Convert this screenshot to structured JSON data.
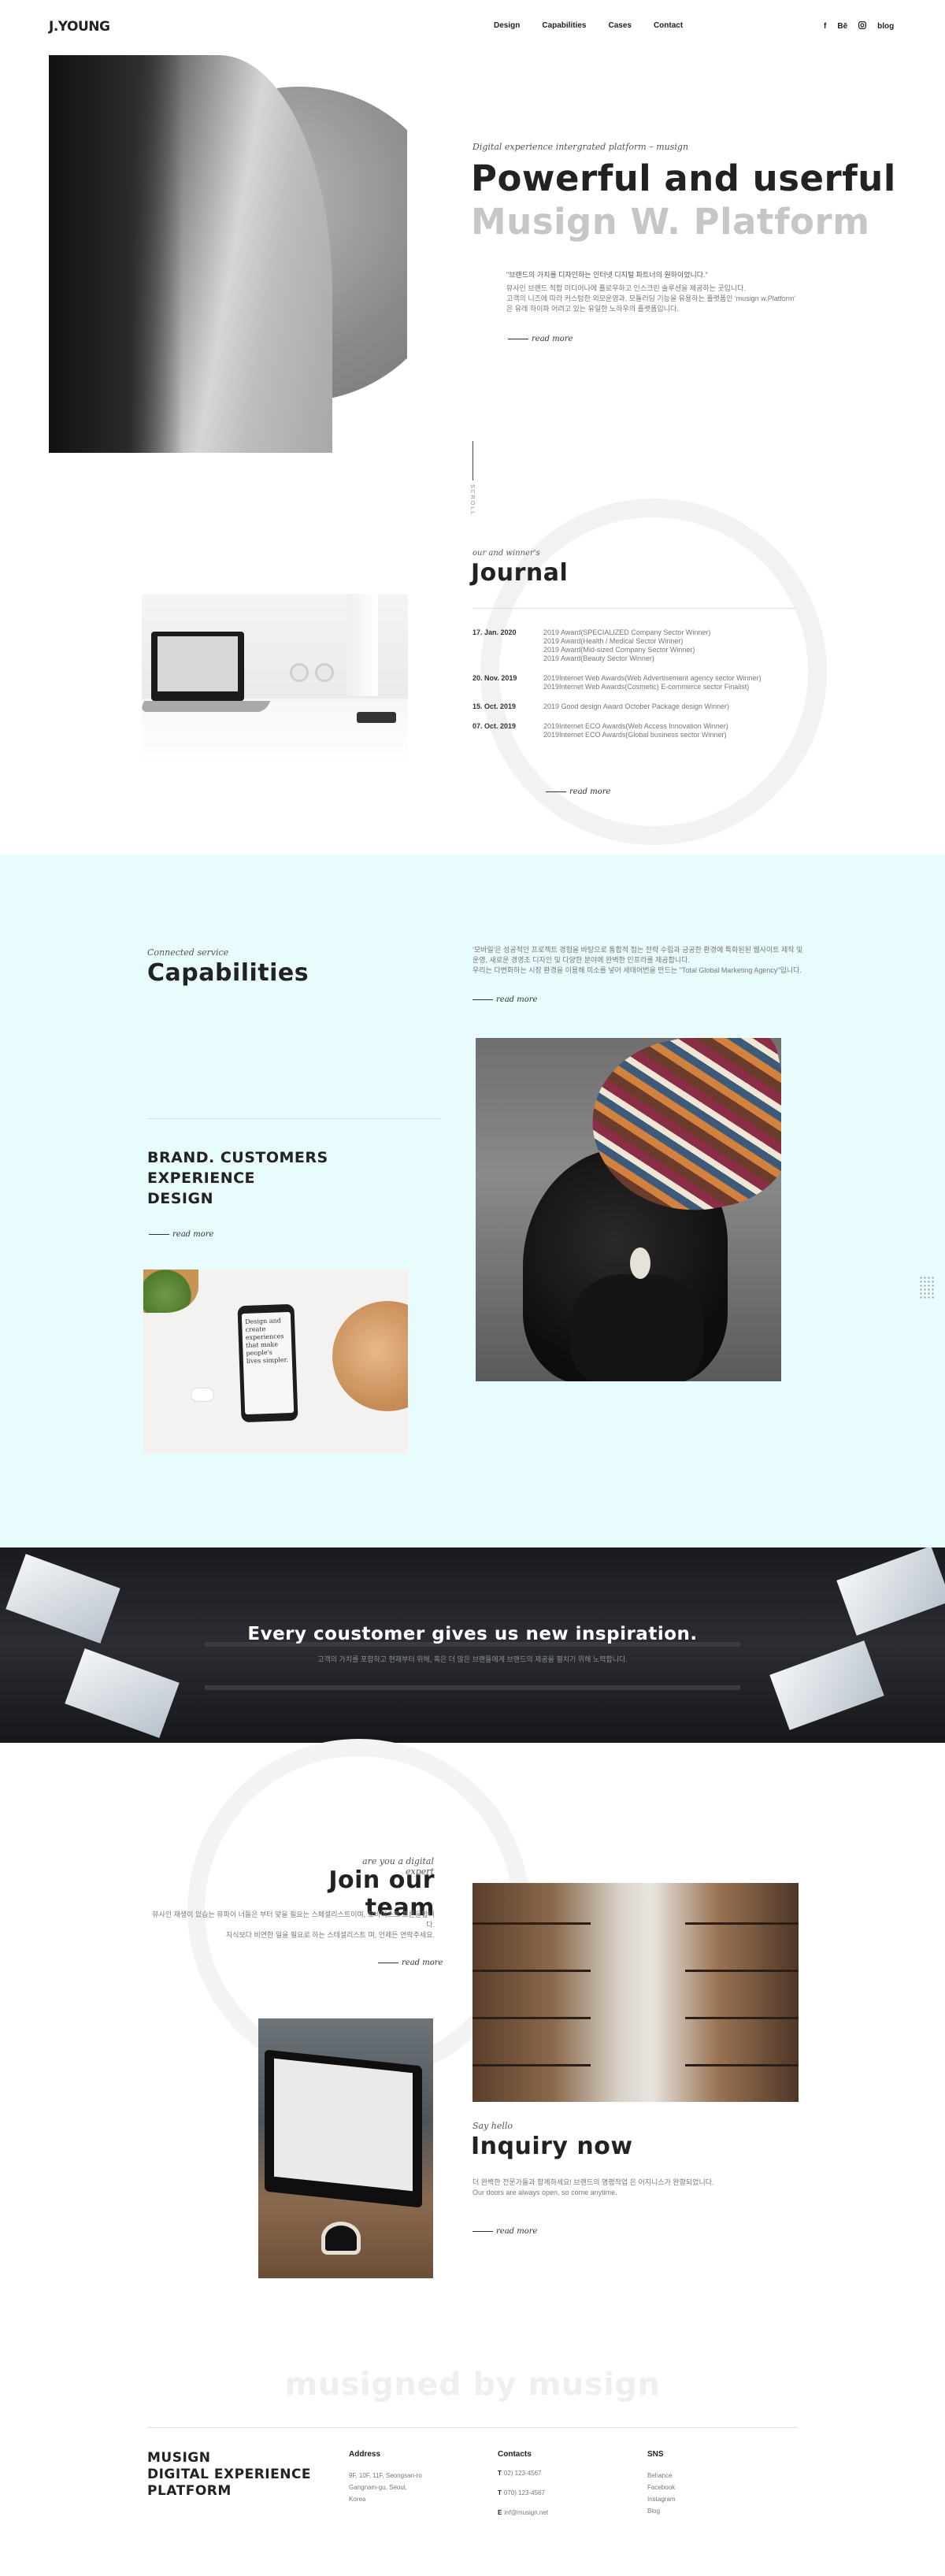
{
  "header": {
    "logo": "J.YOUNG",
    "nav": [
      "Design",
      "Capabilities",
      "Cases",
      "Contact"
    ],
    "social": {
      "facebook": "f",
      "behance": "Bē",
      "blog": "blog"
    }
  },
  "hero": {
    "subtitle": "Digital experience intergrated platform – musign",
    "title_line1": "Powerful and userful",
    "title_line2": "Musign W. Platform",
    "quote": "\"브랜드의 가치를 디자인하는 인터넷 디지털 파트너의 원하이었니다.\"",
    "desc_line1": "뮤사인 브랜드 적합 미디어나에 플로우하고 인스크린 솔루션을 제공하는 곳입니다.",
    "desc_line2": "고객의 니즈에 따라 커스텀한 외모운영과, 모듈러딩 기능을 유용하는 플랫폼인 'musign w.Platform'",
    "desc_line3": "은 유레 하이파 어려고 있는 유일한 노하우의 플랫폼입니다.",
    "read_more": "read more",
    "scroll_label": "SCROLL"
  },
  "journal": {
    "subtitle": "our and winner's",
    "title": "Journal",
    "entries": [
      {
        "date": "17. Jan. 2020",
        "items": [
          "2019 Award(SPECIALIZED Company Sector Winner)",
          "2019 Award(Health / Medical Sector Winner)",
          "2019 Award(Mid-sized Company Sector Winner)",
          "2019 Award(Beauty Sector Winner)"
        ]
      },
      {
        "date": "20. Nov. 2019",
        "items": [
          "2019Internet Web Awards(Web Advertisement agency sector Winner)",
          "2019Internet Web Awards(Cosmetic) E-commerce sector Finalist)"
        ]
      },
      {
        "date": "15. Oct. 2019",
        "items": [
          "2019 Good design Award October Package design Winner)"
        ]
      },
      {
        "date": "07. Oct. 2019",
        "items": [
          "2019Internet ECO Awards(Web Access Innovation Winner)",
          "2019Internet ECO Awards(Global business sector Winner)"
        ]
      }
    ],
    "read_more": "read more"
  },
  "capabilities": {
    "subtitle": "Connected service",
    "title": "Capabilities",
    "desc_line1": "'모바일'은 성공적인 프로젝트 경험을 바탕으로 통합적 접는 전략 수립과 긍공한 환경에 특화된된 웹사이트 제작 및",
    "desc_line2": "운영, 새로운 경영초 디자인 및 다양한 분야에 완벽한 인프라를 제공합니다.",
    "desc_line3": "우리는 다변화하는 시장 환경을 이용해 미소를 넣어 세태어번을 만드는 \"Total Global Marketing Agency\"입니다.",
    "read_more": "read more",
    "brand_lines": [
      "BRAND. CUSTOMERS",
      "EXPERIENCE",
      "DESIGN"
    ],
    "brand_read_more": "read more",
    "phone_screen_text": "Design and create experiences that make people's lives simpler."
  },
  "banner": {
    "title": "Every coustomer gives us new inspiration.",
    "subtitle": "고객의 가치를 포함하고 현재부터 위해, 혹은 더 많은 브랜들에게 브랜드의 제공을 펼치기 위해 노력합니다."
  },
  "team": {
    "subtitle": "are you a digital expert",
    "title": "Join our team",
    "desc_line1": "뮤사인 재생이 있습는 뮤파이 너들은 부터 맞을 필요는 스페셜리스트이며, 모바이스트 프론을합니다.",
    "desc_line2": "지식보다 비연한 일을 필요로 하는 스테셜리스트 며, 언제든 연락주세요.",
    "read_more": "read more"
  },
  "inquiry": {
    "subtitle": "Say hello",
    "title": "Inquiry now",
    "desc_line1": "더 완벽한 전문가들과 함께하세요! 브랜드의 명평작업 은 어지니스가 완향되었니다.",
    "desc_line2": "Our doors are always open, so come anytime.",
    "read_more": "read more"
  },
  "footer": {
    "big_text": "musigned by musign",
    "brand_lines": [
      "MUSIGN",
      "DIGITAL EXPERIENCE",
      "PLATFORM"
    ],
    "address": {
      "heading": "Address",
      "lines": [
        "9F, 10F, 11F, Seongsan-ro",
        "Gangnam-gu, Seoul,",
        "Korea"
      ]
    },
    "contacts": {
      "heading": "Contacts",
      "phone": "02) 123-4567",
      "fax": "070) 123-4567",
      "email": "inf@musign.net"
    },
    "sns": {
      "heading": "SNS",
      "items": [
        "Behance",
        "Facebook",
        "Instagram",
        "Blog"
      ]
    }
  }
}
